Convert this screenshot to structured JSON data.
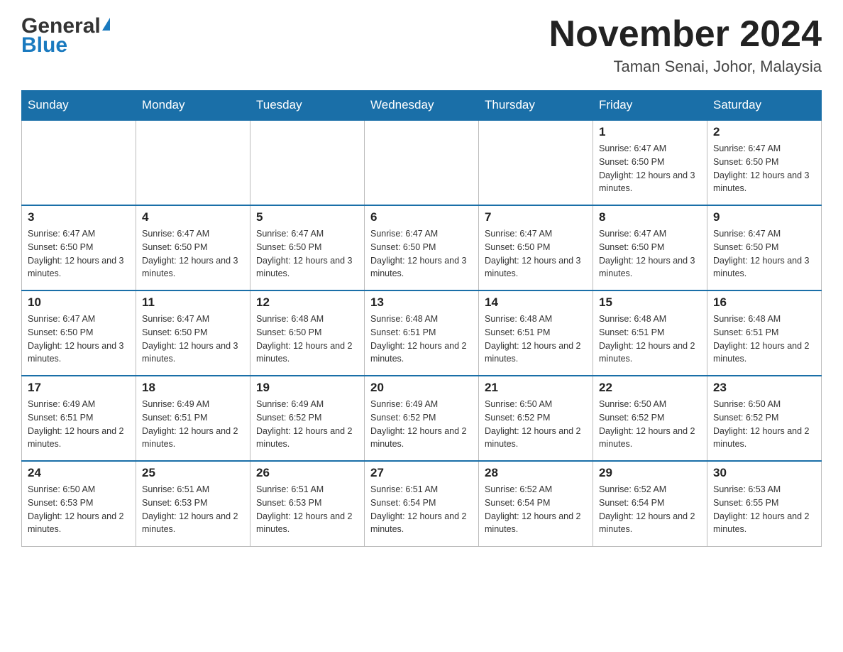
{
  "header": {
    "logo_general": "General",
    "logo_blue": "Blue",
    "month_title": "November 2024",
    "location": "Taman Senai, Johor, Malaysia"
  },
  "days_of_week": [
    "Sunday",
    "Monday",
    "Tuesday",
    "Wednesday",
    "Thursday",
    "Friday",
    "Saturday"
  ],
  "weeks": [
    [
      {
        "day": "",
        "info": ""
      },
      {
        "day": "",
        "info": ""
      },
      {
        "day": "",
        "info": ""
      },
      {
        "day": "",
        "info": ""
      },
      {
        "day": "",
        "info": ""
      },
      {
        "day": "1",
        "info": "Sunrise: 6:47 AM\nSunset: 6:50 PM\nDaylight: 12 hours and 3 minutes."
      },
      {
        "day": "2",
        "info": "Sunrise: 6:47 AM\nSunset: 6:50 PM\nDaylight: 12 hours and 3 minutes."
      }
    ],
    [
      {
        "day": "3",
        "info": "Sunrise: 6:47 AM\nSunset: 6:50 PM\nDaylight: 12 hours and 3 minutes."
      },
      {
        "day": "4",
        "info": "Sunrise: 6:47 AM\nSunset: 6:50 PM\nDaylight: 12 hours and 3 minutes."
      },
      {
        "day": "5",
        "info": "Sunrise: 6:47 AM\nSunset: 6:50 PM\nDaylight: 12 hours and 3 minutes."
      },
      {
        "day": "6",
        "info": "Sunrise: 6:47 AM\nSunset: 6:50 PM\nDaylight: 12 hours and 3 minutes."
      },
      {
        "day": "7",
        "info": "Sunrise: 6:47 AM\nSunset: 6:50 PM\nDaylight: 12 hours and 3 minutes."
      },
      {
        "day": "8",
        "info": "Sunrise: 6:47 AM\nSunset: 6:50 PM\nDaylight: 12 hours and 3 minutes."
      },
      {
        "day": "9",
        "info": "Sunrise: 6:47 AM\nSunset: 6:50 PM\nDaylight: 12 hours and 3 minutes."
      }
    ],
    [
      {
        "day": "10",
        "info": "Sunrise: 6:47 AM\nSunset: 6:50 PM\nDaylight: 12 hours and 3 minutes."
      },
      {
        "day": "11",
        "info": "Sunrise: 6:47 AM\nSunset: 6:50 PM\nDaylight: 12 hours and 3 minutes."
      },
      {
        "day": "12",
        "info": "Sunrise: 6:48 AM\nSunset: 6:50 PM\nDaylight: 12 hours and 2 minutes."
      },
      {
        "day": "13",
        "info": "Sunrise: 6:48 AM\nSunset: 6:51 PM\nDaylight: 12 hours and 2 minutes."
      },
      {
        "day": "14",
        "info": "Sunrise: 6:48 AM\nSunset: 6:51 PM\nDaylight: 12 hours and 2 minutes."
      },
      {
        "day": "15",
        "info": "Sunrise: 6:48 AM\nSunset: 6:51 PM\nDaylight: 12 hours and 2 minutes."
      },
      {
        "day": "16",
        "info": "Sunrise: 6:48 AM\nSunset: 6:51 PM\nDaylight: 12 hours and 2 minutes."
      }
    ],
    [
      {
        "day": "17",
        "info": "Sunrise: 6:49 AM\nSunset: 6:51 PM\nDaylight: 12 hours and 2 minutes."
      },
      {
        "day": "18",
        "info": "Sunrise: 6:49 AM\nSunset: 6:51 PM\nDaylight: 12 hours and 2 minutes."
      },
      {
        "day": "19",
        "info": "Sunrise: 6:49 AM\nSunset: 6:52 PM\nDaylight: 12 hours and 2 minutes."
      },
      {
        "day": "20",
        "info": "Sunrise: 6:49 AM\nSunset: 6:52 PM\nDaylight: 12 hours and 2 minutes."
      },
      {
        "day": "21",
        "info": "Sunrise: 6:50 AM\nSunset: 6:52 PM\nDaylight: 12 hours and 2 minutes."
      },
      {
        "day": "22",
        "info": "Sunrise: 6:50 AM\nSunset: 6:52 PM\nDaylight: 12 hours and 2 minutes."
      },
      {
        "day": "23",
        "info": "Sunrise: 6:50 AM\nSunset: 6:52 PM\nDaylight: 12 hours and 2 minutes."
      }
    ],
    [
      {
        "day": "24",
        "info": "Sunrise: 6:50 AM\nSunset: 6:53 PM\nDaylight: 12 hours and 2 minutes."
      },
      {
        "day": "25",
        "info": "Sunrise: 6:51 AM\nSunset: 6:53 PM\nDaylight: 12 hours and 2 minutes."
      },
      {
        "day": "26",
        "info": "Sunrise: 6:51 AM\nSunset: 6:53 PM\nDaylight: 12 hours and 2 minutes."
      },
      {
        "day": "27",
        "info": "Sunrise: 6:51 AM\nSunset: 6:54 PM\nDaylight: 12 hours and 2 minutes."
      },
      {
        "day": "28",
        "info": "Sunrise: 6:52 AM\nSunset: 6:54 PM\nDaylight: 12 hours and 2 minutes."
      },
      {
        "day": "29",
        "info": "Sunrise: 6:52 AM\nSunset: 6:54 PM\nDaylight: 12 hours and 2 minutes."
      },
      {
        "day": "30",
        "info": "Sunrise: 6:53 AM\nSunset: 6:55 PM\nDaylight: 12 hours and 2 minutes."
      }
    ]
  ]
}
